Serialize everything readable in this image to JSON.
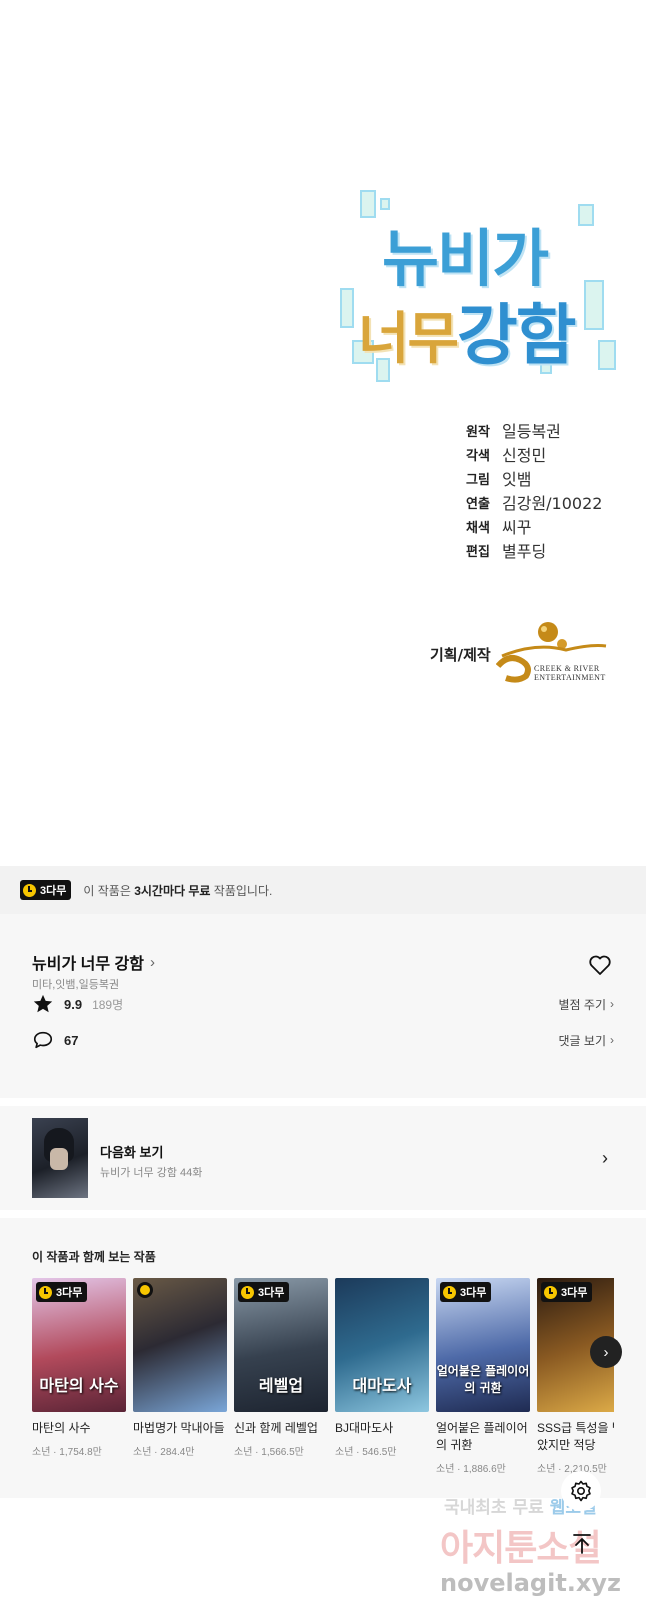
{
  "episode": {
    "logo_line1": "뉴비가",
    "logo_line2_small": "너무",
    "logo_line2_big": "강함",
    "credits": [
      {
        "role": "원작",
        "name": "일등복권"
      },
      {
        "role": "각색",
        "name": "신정민"
      },
      {
        "role": "그림",
        "name": "잇뱀"
      },
      {
        "role": "연출",
        "name": "김강원/10022"
      },
      {
        "role": "채색",
        "name": "씨꾸"
      },
      {
        "role": "편집",
        "name": "별푸딩"
      }
    ],
    "produced_label": "기획/제작",
    "studio_line1": "CREEK & RIVER",
    "studio_line2": "ENTERTAINMENT"
  },
  "notice": {
    "badge": "3다무",
    "text_before": "이 작품은 ",
    "text_bold": "3시간마다 무료",
    "text_after": " 작품입니다."
  },
  "work": {
    "title": "뉴비가 너무 강함",
    "title_chevron": "›",
    "authors": "미타,잇뱀,일등복권",
    "rating": "9.9",
    "rating_count": "189명",
    "rate_action": "별점 주기",
    "comments": "67",
    "comment_action": "댓글 보기",
    "action_chevron": "›"
  },
  "next_episode": {
    "label": "다음화 보기",
    "subtitle": "뉴비가 너무 강함 44화",
    "chevron": "›"
  },
  "recommendations": {
    "title": "이 작품과 함께 보는 작품",
    "badge": "3다무",
    "items": [
      {
        "name": "마탄의 사수",
        "meta": "소년 · 1,754.8만",
        "cover_text": "마탄의 사수",
        "badge": true,
        "bg": "#b24a5c"
      },
      {
        "name": "마법명가 막내아들",
        "meta": "소년 · 284.4만",
        "cover_text": "",
        "badge": false,
        "bg": "#2c2a33"
      },
      {
        "name": "신과 함께 레벨업",
        "meta": "소년 · 1,566.5만",
        "cover_text": "레벨업",
        "badge": true,
        "bg": "#36414f"
      },
      {
        "name": "BJ대마도사",
        "meta": "소년 · 546.5만",
        "cover_text": "대마도사",
        "badge": false,
        "bg": "#2f6b8f"
      },
      {
        "name": "얼어붙은 플레이어의 귀환",
        "meta": "소년 · 1,886.6만",
        "cover_text": "얼어붙은 플레이어의 귀환",
        "badge": true,
        "bg": "#4e6aa8"
      },
      {
        "name": "SSS급 특성을 받았지만 적당",
        "meta": "소년 · 2,210.5만",
        "cover_text": "",
        "badge": true,
        "bg": "#8a5a22"
      }
    ],
    "next_arrow": "›"
  },
  "watermark": {
    "line1_a": "국내최초 무료 ",
    "line1_b": "웹소설",
    "line2": "아지툰소설",
    "line3": "novelagit.xyz"
  },
  "colors": {
    "accent_yellow": "#f7c600",
    "badge_black": "#111111",
    "logo_blue": "#3c9fd6",
    "logo_gold": "#d9a53b"
  },
  "icons": [
    "star-icon",
    "comment-icon",
    "heart-icon",
    "settings-icon",
    "arrow-up-icon",
    "chevron-right-icon",
    "clock-icon"
  ]
}
